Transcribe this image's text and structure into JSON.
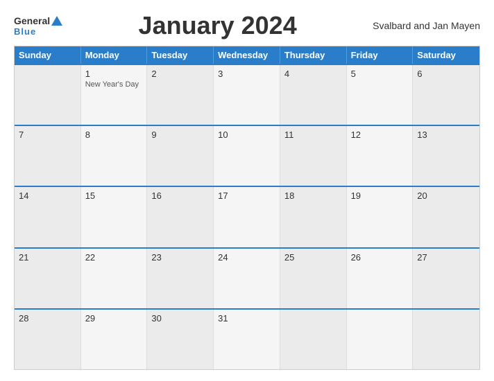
{
  "header": {
    "title": "January 2024",
    "region": "Svalbard and Jan Mayen",
    "logo_general": "General",
    "logo_blue": "Blue"
  },
  "days_of_week": [
    "Sunday",
    "Monday",
    "Tuesday",
    "Wednesday",
    "Thursday",
    "Friday",
    "Saturday"
  ],
  "weeks": [
    [
      {
        "day": "",
        "events": []
      },
      {
        "day": "1",
        "events": [
          "New Year's Day"
        ]
      },
      {
        "day": "2",
        "events": []
      },
      {
        "day": "3",
        "events": []
      },
      {
        "day": "4",
        "events": []
      },
      {
        "day": "5",
        "events": []
      },
      {
        "day": "6",
        "events": []
      }
    ],
    [
      {
        "day": "7",
        "events": []
      },
      {
        "day": "8",
        "events": []
      },
      {
        "day": "9",
        "events": []
      },
      {
        "day": "10",
        "events": []
      },
      {
        "day": "11",
        "events": []
      },
      {
        "day": "12",
        "events": []
      },
      {
        "day": "13",
        "events": []
      }
    ],
    [
      {
        "day": "14",
        "events": []
      },
      {
        "day": "15",
        "events": []
      },
      {
        "day": "16",
        "events": []
      },
      {
        "day": "17",
        "events": []
      },
      {
        "day": "18",
        "events": []
      },
      {
        "day": "19",
        "events": []
      },
      {
        "day": "20",
        "events": []
      }
    ],
    [
      {
        "day": "21",
        "events": []
      },
      {
        "day": "22",
        "events": []
      },
      {
        "day": "23",
        "events": []
      },
      {
        "day": "24",
        "events": []
      },
      {
        "day": "25",
        "events": []
      },
      {
        "day": "26",
        "events": []
      },
      {
        "day": "27",
        "events": []
      }
    ],
    [
      {
        "day": "28",
        "events": []
      },
      {
        "day": "29",
        "events": []
      },
      {
        "day": "30",
        "events": []
      },
      {
        "day": "31",
        "events": []
      },
      {
        "day": "",
        "events": []
      },
      {
        "day": "",
        "events": []
      },
      {
        "day": "",
        "events": []
      }
    ]
  ],
  "colors": {
    "header_bg": "#2a7dc9",
    "header_text": "#ffffff",
    "cell_bg_alt": "#f5f5f5",
    "cell_bg": "#ebebeb",
    "border": "#2a7dc9"
  }
}
